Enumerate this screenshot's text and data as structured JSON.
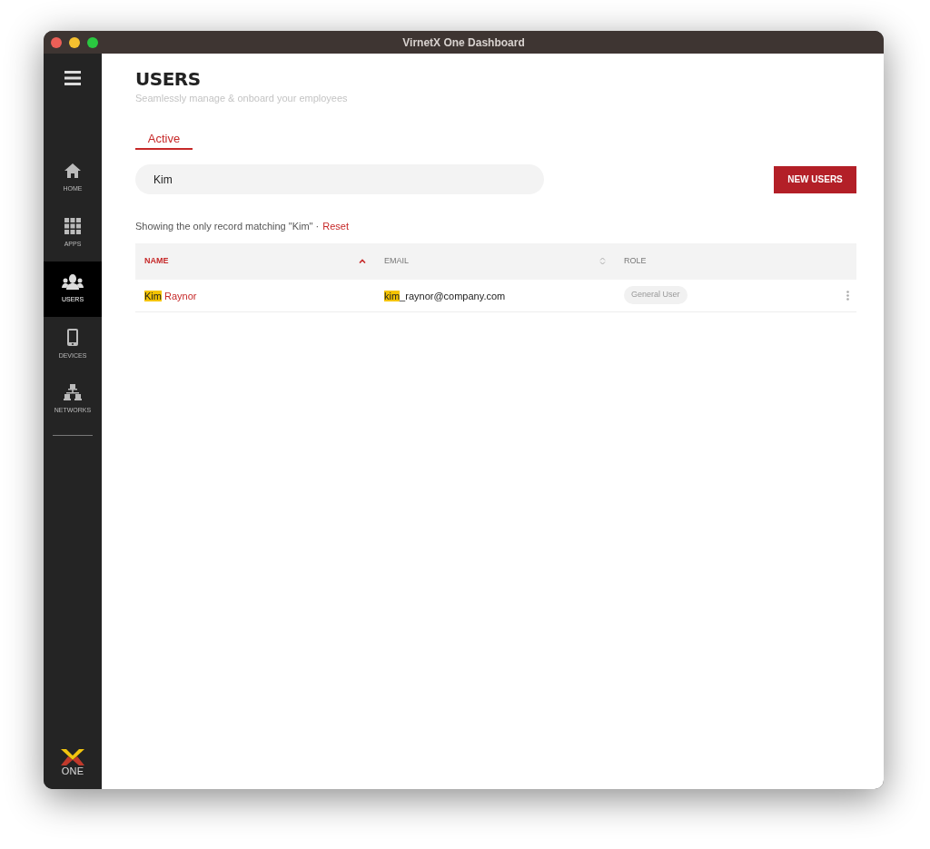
{
  "window": {
    "title": "VirnetX One Dashboard"
  },
  "sidebar": {
    "items": [
      {
        "kind": "home",
        "label": "HOME",
        "selected": false
      },
      {
        "kind": "apps",
        "label": "APPS",
        "selected": false
      },
      {
        "kind": "users",
        "label": "USERS",
        "selected": true
      },
      {
        "kind": "devices",
        "label": "DEVICES",
        "selected": false
      },
      {
        "kind": "networks",
        "label": "NETWORKS",
        "selected": false
      }
    ],
    "logo": {
      "text": "ONE"
    }
  },
  "header": {
    "title": "USERS",
    "subtitle": "Seamlessly manage & onboard your employees"
  },
  "tabs": [
    {
      "label": "Active",
      "selected": true
    }
  ],
  "search": {
    "value": "Kim"
  },
  "new_button": "NEW USERS",
  "summary": {
    "text": "Showing the only record matching \"Kim\" ·",
    "link": "Reset"
  },
  "table": {
    "columns": [
      {
        "label": "NAME",
        "sortable": true,
        "sorted": true
      },
      {
        "label": "EMAIL",
        "sortable": true,
        "sorted": false
      },
      {
        "label": "ROLE",
        "sortable": false,
        "sorted": false
      }
    ],
    "rows": [
      {
        "name": {
          "match": "Kim",
          "rest": " Raynor"
        },
        "email": {
          "match": "kim",
          "rest": "_raynor@company.com"
        },
        "role": "General User"
      }
    ]
  }
}
